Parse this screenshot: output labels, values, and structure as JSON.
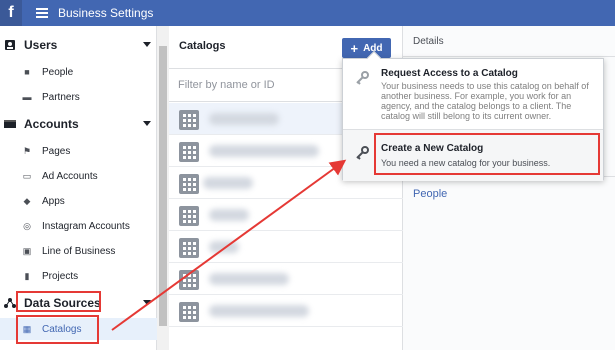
{
  "topbar": {
    "logo": "f",
    "title": "Business Settings"
  },
  "sidebar": {
    "sections": [
      {
        "label": "Users",
        "icon": "users-icon"
      },
      {
        "label": "Accounts",
        "icon": "accounts-icon"
      },
      {
        "label": "Data Sources",
        "icon": "data-sources-icon"
      }
    ],
    "items": [
      {
        "label": "People",
        "icon": "person-icon"
      },
      {
        "label": "Partners",
        "icon": "briefcase-icon"
      },
      {
        "label": "Pages",
        "icon": "flag-icon"
      },
      {
        "label": "Ad Accounts",
        "icon": "ad-account-icon"
      },
      {
        "label": "Apps",
        "icon": "cube-icon"
      },
      {
        "label": "Instagram Accounts",
        "icon": "instagram-icon"
      },
      {
        "label": "Line of Business",
        "icon": "briefcase-icon"
      },
      {
        "label": "Projects",
        "icon": "folder-icon"
      },
      {
        "label": "Catalogs",
        "icon": "grid-icon"
      }
    ]
  },
  "catalogs": {
    "title": "Catalogs",
    "add_label": "Add",
    "filter_placeholder": "Filter by name or ID"
  },
  "details": {
    "title": "Details",
    "people_label": "People"
  },
  "dropdown": {
    "options": [
      {
        "title": "Request Access to a Catalog",
        "description": "Your business needs to use this catalog on behalf of another business. For example, you work for an agency, and the catalog belongs to a client. The catalog will still belong to its current owner."
      },
      {
        "title": "Create a New Catalog",
        "description": "You need a new catalog for your business."
      }
    ]
  },
  "colors": {
    "brand": "#4267b2",
    "annotation": "#e53935"
  }
}
